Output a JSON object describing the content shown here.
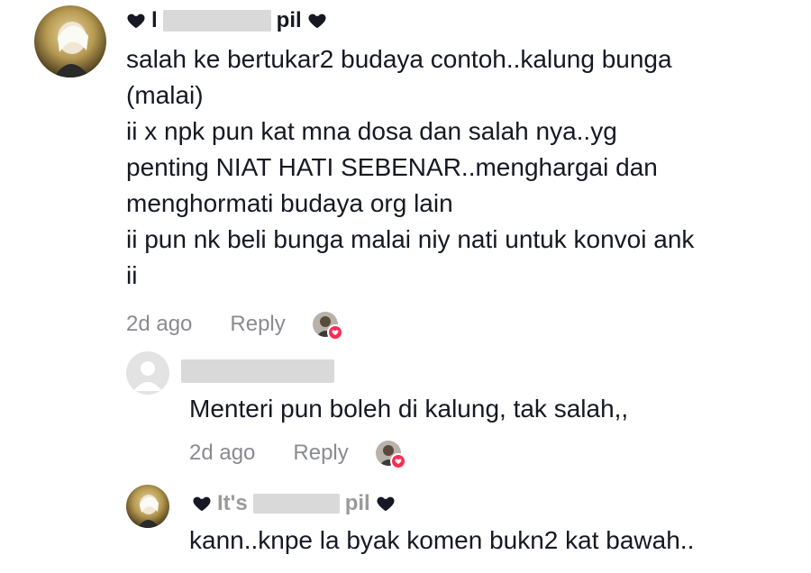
{
  "colors": {
    "text": "#161823",
    "meta": "#8a8b91",
    "like_badge": "#fe2c55",
    "redaction": "#d9d9d9"
  },
  "comments": [
    {
      "author_visible": "l",
      "author_tail": "pil",
      "text": "salah ke bertukar2 budaya contoh..kalung bunga\n(malai)\nii x npk pun kat mna dosa dan salah nya..yg\npenting NIAT HATI SEBENAR..menghargai dan\nmenghormati budaya org lain\nii pun nk beli bunga malai niy nati untuk konvoi ank\nii",
      "time": "2d ago",
      "reply_label": "Reply",
      "icons": {
        "author_decor": "black-heart-icon",
        "liked_by": "creator-like-avatar-icon"
      }
    },
    {
      "text": "Menteri pun boleh di kalung, tak salah,,",
      "time": "2d ago",
      "reply_label": "Reply",
      "icons": {
        "avatar": "default-avatar-icon",
        "liked_by": "creator-like-avatar-icon"
      }
    },
    {
      "author_visible": "It's",
      "author_tail": "pil",
      "text": "kann..knpe la byak komen bukn2 kat bawah..",
      "icons": {
        "author_decor": "black-heart-icon"
      }
    }
  ]
}
